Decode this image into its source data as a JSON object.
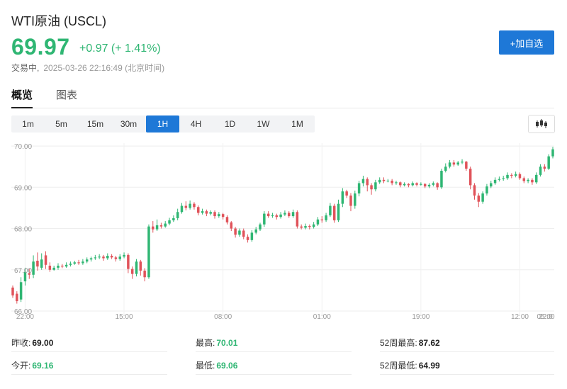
{
  "header": {
    "title": "WTI原油 (USCL)",
    "price": "69.97",
    "change": "+0.97 (+ 1.41%)",
    "status": "交易中,",
    "timestamp": "2025-03-26 22:16:49 (北京时间)",
    "add_button": "+加自选"
  },
  "tabs": [
    {
      "label": "概览",
      "active": true
    },
    {
      "label": "图表",
      "active": false
    }
  ],
  "timeframes": [
    "1m",
    "5m",
    "15m",
    "30m",
    "1H",
    "4H",
    "1D",
    "1W",
    "1M"
  ],
  "active_timeframe": "1H",
  "chart_button_icon": "candlestick-chart-icon",
  "colors": {
    "up": "#2fb673",
    "down": "#e0535a",
    "accent": "#1e78d7"
  },
  "chart_data": {
    "type": "candlestick",
    "y_ticks": [
      "70.00",
      "69.00",
      "68.00",
      "67.00",
      "66.00"
    ],
    "y_range": [
      65.88,
      70.07
    ],
    "x_ticks": [
      "22:00",
      "15:00",
      "08:00",
      "01:00",
      "19:00",
      "12:00",
      "05:00",
      "22:0"
    ],
    "x_tick_index": [
      3,
      27,
      51,
      75,
      99,
      123,
      147,
      171
    ],
    "grid": true,
    "candles": [
      [
        66.57,
        66.38,
        66.62,
        66.32
      ],
      [
        66.42,
        66.24,
        66.48,
        66.18
      ],
      [
        66.28,
        66.7,
        66.82,
        66.22
      ],
      [
        66.72,
        66.95,
        67.05,
        66.62
      ],
      [
        66.92,
        66.88,
        67.02,
        66.78
      ],
      [
        66.88,
        67.2,
        67.35,
        66.8
      ],
      [
        67.22,
        67.08,
        67.42,
        66.98
      ],
      [
        67.05,
        67.25,
        67.4,
        67.0
      ],
      [
        67.35,
        67.12,
        67.45,
        67.02
      ],
      [
        67.1,
        67.0,
        67.18,
        66.95
      ],
      [
        67.0,
        67.05,
        67.1,
        66.98
      ],
      [
        67.05,
        67.1,
        67.16,
        67.0
      ],
      [
        67.1,
        67.08,
        67.14,
        67.04
      ],
      [
        67.08,
        67.12,
        67.18,
        67.05
      ],
      [
        67.12,
        67.15,
        67.2,
        67.08
      ],
      [
        67.15,
        67.18,
        67.22,
        67.12
      ],
      [
        67.18,
        67.16,
        67.24,
        67.12
      ],
      [
        67.16,
        67.2,
        67.26,
        67.12
      ],
      [
        67.2,
        67.25,
        67.3,
        67.16
      ],
      [
        67.25,
        67.28,
        67.32,
        67.2
      ],
      [
        67.28,
        67.3,
        67.36,
        67.24
      ],
      [
        67.3,
        67.32,
        67.38,
        67.26
      ],
      [
        67.32,
        67.28,
        67.36,
        67.22
      ],
      [
        67.28,
        67.34,
        67.4,
        67.24
      ],
      [
        67.34,
        67.3,
        67.38,
        67.26
      ],
      [
        67.3,
        67.26,
        67.34,
        67.2
      ],
      [
        67.26,
        67.32,
        67.38,
        67.22
      ],
      [
        67.32,
        67.36,
        67.42,
        67.28
      ],
      [
        67.36,
        67.02,
        67.4,
        66.92
      ],
      [
        67.02,
        66.9,
        67.08,
        66.78
      ],
      [
        66.9,
        67.2,
        67.26,
        66.84
      ],
      [
        67.2,
        66.98,
        67.24,
        66.86
      ],
      [
        66.98,
        66.82,
        67.04,
        66.72
      ],
      [
        66.82,
        68.05,
        68.1,
        66.78
      ],
      [
        68.05,
        67.98,
        68.18,
        67.9
      ],
      [
        67.98,
        68.08,
        68.22,
        67.94
      ],
      [
        68.08,
        68.05,
        68.14,
        68.0
      ],
      [
        68.05,
        68.12,
        68.18,
        68.02
      ],
      [
        68.12,
        68.2,
        68.26,
        68.08
      ],
      [
        68.2,
        68.25,
        68.32,
        68.16
      ],
      [
        68.25,
        68.4,
        68.48,
        68.2
      ],
      [
        68.4,
        68.55,
        68.62,
        68.36
      ],
      [
        68.55,
        68.5,
        68.66,
        68.44
      ],
      [
        68.5,
        68.6,
        68.68,
        68.46
      ],
      [
        68.6,
        68.52,
        68.64,
        68.46
      ],
      [
        68.52,
        68.38,
        68.56,
        68.32
      ],
      [
        68.38,
        68.42,
        68.48,
        68.34
      ],
      [
        68.42,
        68.36,
        68.46,
        68.3
      ],
      [
        68.36,
        68.4,
        68.44,
        68.32
      ],
      [
        68.4,
        68.3,
        68.44,
        68.24
      ],
      [
        68.3,
        68.35,
        68.4,
        68.26
      ],
      [
        68.35,
        68.28,
        68.38,
        68.22
      ],
      [
        68.28,
        68.15,
        68.32,
        68.1
      ],
      [
        68.15,
        68.0,
        68.18,
        67.94
      ],
      [
        68.0,
        67.85,
        68.04,
        67.78
      ],
      [
        67.85,
        67.95,
        68.0,
        67.8
      ],
      [
        67.95,
        67.8,
        68.0,
        67.74
      ],
      [
        67.8,
        67.72,
        67.86,
        67.66
      ],
      [
        67.72,
        67.9,
        67.96,
        67.68
      ],
      [
        67.9,
        67.98,
        68.04,
        67.86
      ],
      [
        67.98,
        68.1,
        68.14,
        67.94
      ],
      [
        68.1,
        68.36,
        68.42,
        68.04
      ],
      [
        68.36,
        68.3,
        68.42,
        68.26
      ],
      [
        68.3,
        68.32,
        68.38,
        68.26
      ],
      [
        68.32,
        68.28,
        68.36,
        68.22
      ],
      [
        68.28,
        68.34,
        68.4,
        68.24
      ],
      [
        68.34,
        68.38,
        68.44,
        68.3
      ],
      [
        68.38,
        68.3,
        68.42,
        68.26
      ],
      [
        68.3,
        68.4,
        68.46,
        68.26
      ],
      [
        68.4,
        68.05,
        68.44,
        68.0
      ],
      [
        68.05,
        68.02,
        68.1,
        67.98
      ],
      [
        68.02,
        68.06,
        68.12,
        67.98
      ],
      [
        68.06,
        68.04,
        68.1,
        67.98
      ],
      [
        68.04,
        68.1,
        68.16,
        68.0
      ],
      [
        68.1,
        68.22,
        68.28,
        68.06
      ],
      [
        68.22,
        68.2,
        68.3,
        68.14
      ],
      [
        68.2,
        68.32,
        68.38,
        68.16
      ],
      [
        68.32,
        68.55,
        68.62,
        68.28
      ],
      [
        68.55,
        68.2,
        68.6,
        68.14
      ],
      [
        68.2,
        68.6,
        68.7,
        68.16
      ],
      [
        68.6,
        68.9,
        68.98,
        68.52
      ],
      [
        68.9,
        68.8,
        68.94,
        68.74
      ],
      [
        68.8,
        68.55,
        68.86,
        68.42
      ],
      [
        68.55,
        68.85,
        68.92,
        68.48
      ],
      [
        68.85,
        69.1,
        69.16,
        68.78
      ],
      [
        69.1,
        69.2,
        69.28,
        69.02
      ],
      [
        69.2,
        69.05,
        69.24,
        68.9
      ],
      [
        69.05,
        68.95,
        69.1,
        68.82
      ],
      [
        68.95,
        69.12,
        69.18,
        68.9
      ],
      [
        69.12,
        69.18,
        69.24,
        69.08
      ],
      [
        69.18,
        69.15,
        69.24,
        69.1
      ],
      [
        69.15,
        69.16,
        69.2,
        69.12
      ],
      [
        69.16,
        69.1,
        69.2,
        69.05
      ],
      [
        69.1,
        69.12,
        69.16,
        69.06
      ],
      [
        69.12,
        69.05,
        69.14,
        69.0
      ],
      [
        69.05,
        69.08,
        69.12,
        69.02
      ],
      [
        69.08,
        69.05,
        69.1,
        69.0
      ],
      [
        69.05,
        69.1,
        69.14,
        69.02
      ],
      [
        69.1,
        69.06,
        69.12,
        69.02
      ],
      [
        69.06,
        69.08,
        69.12,
        69.04
      ],
      [
        69.08,
        69.02,
        69.1,
        68.98
      ],
      [
        69.02,
        69.06,
        69.1,
        68.98
      ],
      [
        69.06,
        69.1,
        69.14,
        69.02
      ],
      [
        69.1,
        69.0,
        69.12,
        68.94
      ],
      [
        69.0,
        69.4,
        69.45,
        68.96
      ],
      [
        69.4,
        69.5,
        69.58,
        69.36
      ],
      [
        69.5,
        69.6,
        69.66,
        69.46
      ],
      [
        69.6,
        69.55,
        69.66,
        69.5
      ],
      [
        69.55,
        69.6,
        69.64,
        69.52
      ],
      [
        69.6,
        69.62,
        69.68,
        69.56
      ],
      [
        69.62,
        69.45,
        69.64,
        69.4
      ],
      [
        69.45,
        69.05,
        69.5,
        68.95
      ],
      [
        69.05,
        68.8,
        69.1,
        68.7
      ],
      [
        68.8,
        68.65,
        68.86,
        68.52
      ],
      [
        68.65,
        68.85,
        68.9,
        68.6
      ],
      [
        68.85,
        69.02,
        69.08,
        68.8
      ],
      [
        69.02,
        69.1,
        69.16,
        68.98
      ],
      [
        69.1,
        69.18,
        69.24,
        69.06
      ],
      [
        69.18,
        69.2,
        69.26,
        69.14
      ],
      [
        69.2,
        69.22,
        69.28,
        69.16
      ],
      [
        69.22,
        69.3,
        69.36,
        69.18
      ],
      [
        69.3,
        69.28,
        69.34,
        69.22
      ],
      [
        69.28,
        69.32,
        69.38,
        69.24
      ],
      [
        69.32,
        69.22,
        69.36,
        69.18
      ],
      [
        69.22,
        69.15,
        69.26,
        69.1
      ],
      [
        69.15,
        69.18,
        69.22,
        69.1
      ],
      [
        69.18,
        69.12,
        69.22,
        69.06
      ],
      [
        69.12,
        69.3,
        69.36,
        69.08
      ],
      [
        69.3,
        69.5,
        69.56,
        69.26
      ],
      [
        69.5,
        69.45,
        69.56,
        69.38
      ],
      [
        69.45,
        69.75,
        69.8,
        69.42
      ],
      [
        69.75,
        69.92,
        69.98,
        69.7
      ]
    ]
  },
  "stats": {
    "prev_close_label": "昨收:",
    "prev_close": "69.00",
    "open_label": "今开:",
    "open": "69.16",
    "high_label": "最高:",
    "high": "70.01",
    "low_label": "最低:",
    "low": "69.06",
    "w52_high_label": "52周最高:",
    "w52_high": "87.62",
    "w52_low_label": "52周最低:",
    "w52_low": "64.99"
  }
}
